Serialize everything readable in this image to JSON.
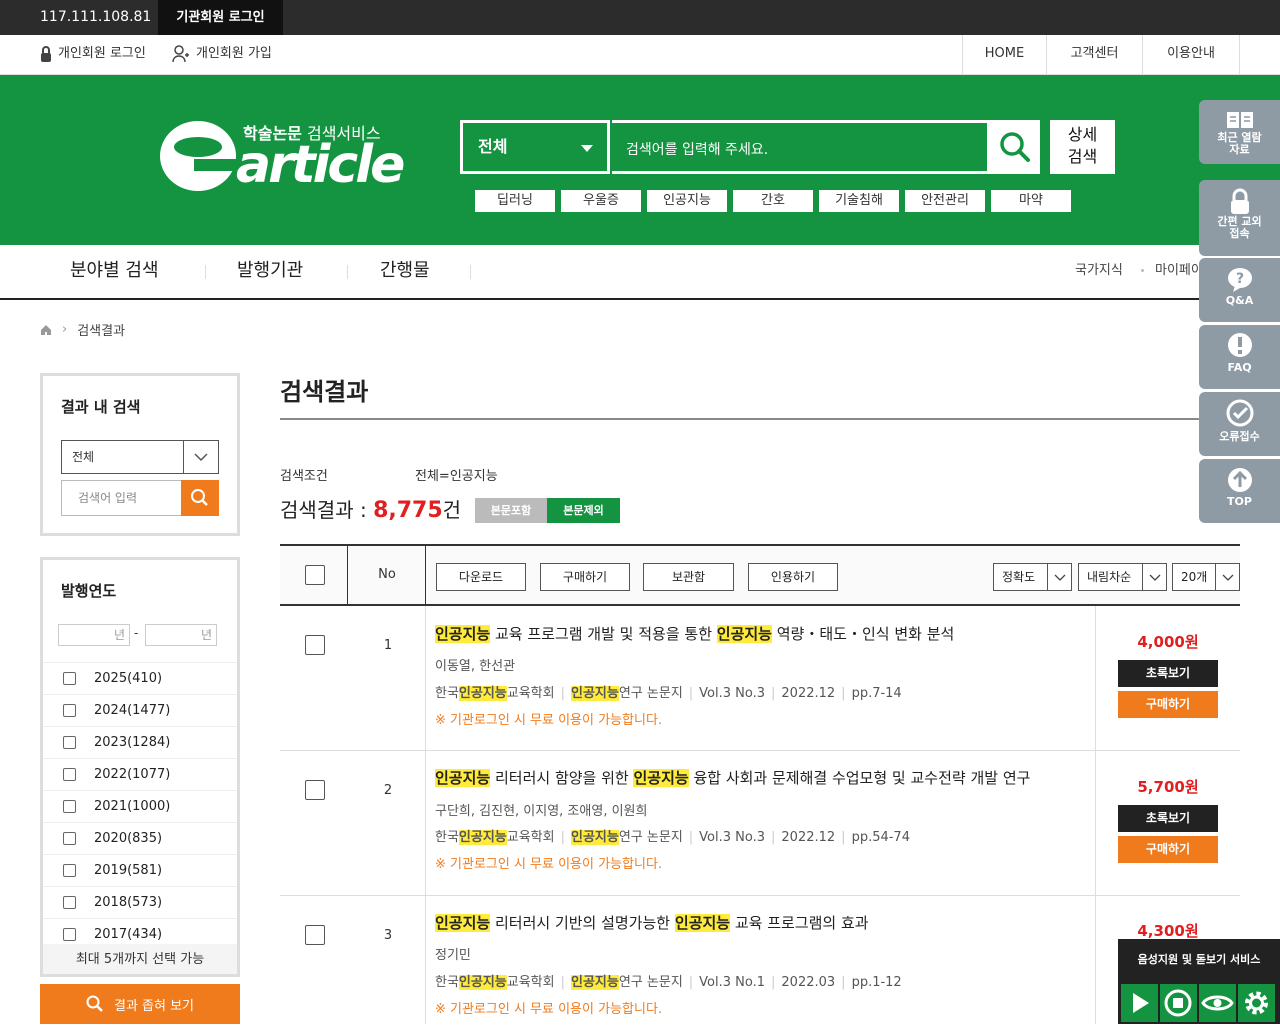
{
  "top": {
    "ip": "117.111.108.81",
    "inst_login": "기관회원 로그인"
  },
  "util": {
    "login": "개인회원 로그인",
    "join": "개인회원 가입",
    "home": "HOME",
    "cs": "고객센터",
    "guide": "이용안내"
  },
  "header": {
    "logo": "earticle",
    "subtitle_bold": "학술논문",
    "subtitle": " 검색서비스",
    "select": "전체",
    "placeholder": "검색어를 입력해 주세요.",
    "adv1": "상세",
    "adv2": "검색",
    "keywords": [
      "딥러닝",
      "우울증",
      "인공지능",
      "간호",
      "기술침해",
      "안전관리",
      "마약"
    ]
  },
  "gnb": {
    "items": [
      "분야별 검색",
      "발행기관",
      "간행물"
    ],
    "sub": [
      "국가지식",
      "마이페이"
    ]
  },
  "crumb": "검색결과",
  "left": {
    "title": "결과 내 검색",
    "select": "전체",
    "placeholder": "검색어 입력",
    "year_title": "발행연도",
    "year_unit": "년",
    "years": [
      "2025(410)",
      "2024(1477)",
      "2023(1284)",
      "2022(1077)",
      "2021(1000)",
      "2020(835)",
      "2019(581)",
      "2018(573)",
      "2017(434)"
    ],
    "note": "최대 5개까지 선택 가능",
    "narrow": "결과 좁혀 보기"
  },
  "main": {
    "title": "검색결과",
    "cond_label": "검색조건",
    "cond_value": "전체=인공지능",
    "count_label": "검색결과 : ",
    "count": "8,775",
    "count_unit": "건",
    "tag_inc": "본문포함",
    "tag_exc": "본문제외"
  },
  "table": {
    "no": "No",
    "download": "다운로드",
    "buy": "구매하기",
    "save": "보관함",
    "cite": "인용하기",
    "sort": "정확도",
    "order": "내림차순",
    "per": "20개"
  },
  "results": [
    {
      "no": "1",
      "t0": "인공지능",
      "t1": " 교육 프로그램 개발 및 적용을 통한 ",
      "t2": "인공지능",
      "t3": " 역량・태도・인식 변화 분석",
      "authors": "이동열, 한선관",
      "pub_a": "한국",
      "pub_h": "인공지능",
      "pub_b": "교육학회",
      "jour_h": "인공지능",
      "jour_b": "연구 논문지",
      "vol": "Vol.3 No.3",
      "date": "2022.12",
      "pages": "pp.7-14",
      "note": "※ 기관로그인 시 무료 이용이 가능합니다.",
      "price": "4,000원",
      "abs": "초록보기",
      "buy": "구매하기"
    },
    {
      "no": "2",
      "t0": "인공지능",
      "t1": " 리터러시 함양을 위한 ",
      "t2": "인공지능",
      "t3": " 융합 사회과 문제해결 수업모형 및 교수전략 개발 연구",
      "authors": "구단희, 김진현, 이지영, 조애영, 이원희",
      "pub_a": "한국",
      "pub_h": "인공지능",
      "pub_b": "교육학회",
      "jour_h": "인공지능",
      "jour_b": "연구 논문지",
      "vol": "Vol.3 No.3",
      "date": "2022.12",
      "pages": "pp.54-74",
      "note": "※ 기관로그인 시 무료 이용이 가능합니다.",
      "price": "5,700원",
      "abs": "초록보기",
      "buy": "구매하기"
    },
    {
      "no": "3",
      "t0": "인공지능",
      "t1": " 리터러시 기반의 설명가능한 ",
      "t2": "인공지능",
      "t3": " 교육 프로그램의 효과",
      "authors": "정기민",
      "pub_a": "한국",
      "pub_h": "인공지능",
      "pub_b": "교육학회",
      "jour_h": "인공지능",
      "jour_b": "연구 논문지",
      "vol": "Vol.3 No.1",
      "date": "2022.03",
      "pages": "pp.1-12",
      "note": "※ 기관로그인 시 무료 이용이 가능합니다.",
      "price": "4,300원",
      "abs": "초록보기",
      "buy": "구매하기"
    }
  ],
  "quick": {
    "recent": "최근 열람 자료",
    "easy": "간편 교외접속",
    "qa": "Q&A",
    "faq": "FAQ",
    "err": "오류접수",
    "top": "TOP"
  },
  "voice": {
    "title": "음성지원 및 돋보기 서비스"
  },
  "colors": {
    "brand_green": "#149441",
    "accent_orange": "#f07b1d",
    "price_red": "#e02020",
    "highlight": "#ffeb3b"
  }
}
